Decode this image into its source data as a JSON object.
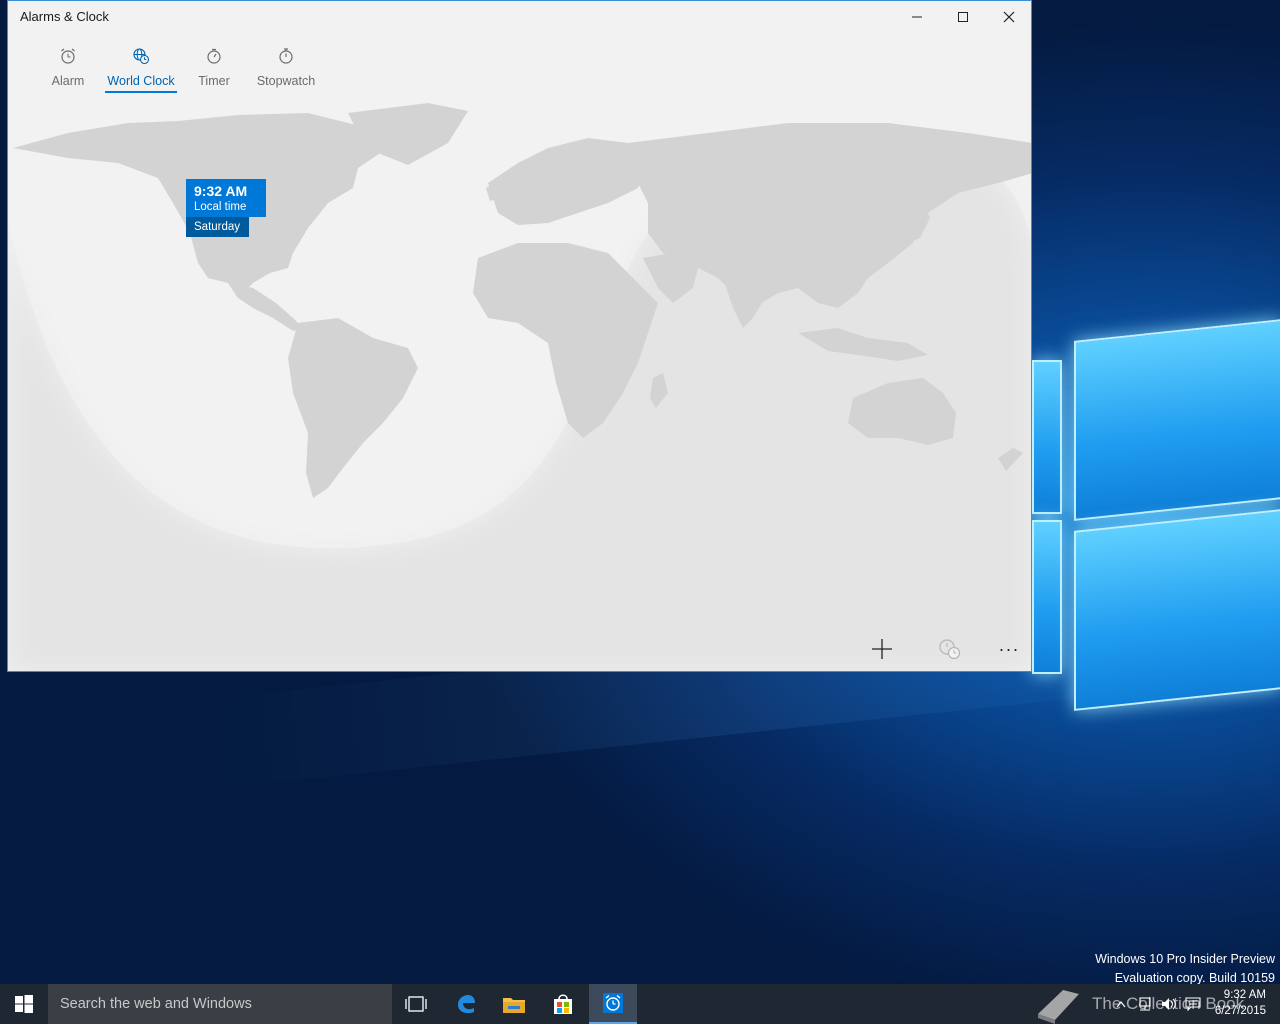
{
  "window": {
    "title": "Alarms & Clock",
    "minimize_icon": "minimize-icon",
    "maximize_icon": "maximize-icon",
    "close_icon": "close-icon"
  },
  "tabs": [
    {
      "label": "Alarm",
      "icon": "alarm-icon",
      "active": false
    },
    {
      "label": "World Clock",
      "icon": "globe-clock-icon",
      "active": true
    },
    {
      "label": "Timer",
      "icon": "timer-icon",
      "active": false
    },
    {
      "label": "Stopwatch",
      "icon": "stopwatch-icon",
      "active": false
    }
  ],
  "local_time": {
    "time": "9:32 AM",
    "label": "Local time",
    "day": "Saturday"
  },
  "commands": {
    "add_icon": "plus-icon",
    "compare_icon": "compare-clock-icon",
    "more_label": "···"
  },
  "watermark": {
    "line1": "Windows 10 Pro Insider Preview",
    "line2": "Evaluation copy. Build 10159"
  },
  "taskbar": {
    "search_placeholder": "Search the web and Windows",
    "clock_time": "9:32 AM",
    "clock_date": "6/27/2015",
    "brand_overlay": "The Collection Book"
  },
  "colors": {
    "accent": "#0078d7",
    "accent_dark": "#005a9e",
    "land": "#d3d3d3",
    "map_bg": "#f0f0f0",
    "taskbar": "#1f2732"
  }
}
